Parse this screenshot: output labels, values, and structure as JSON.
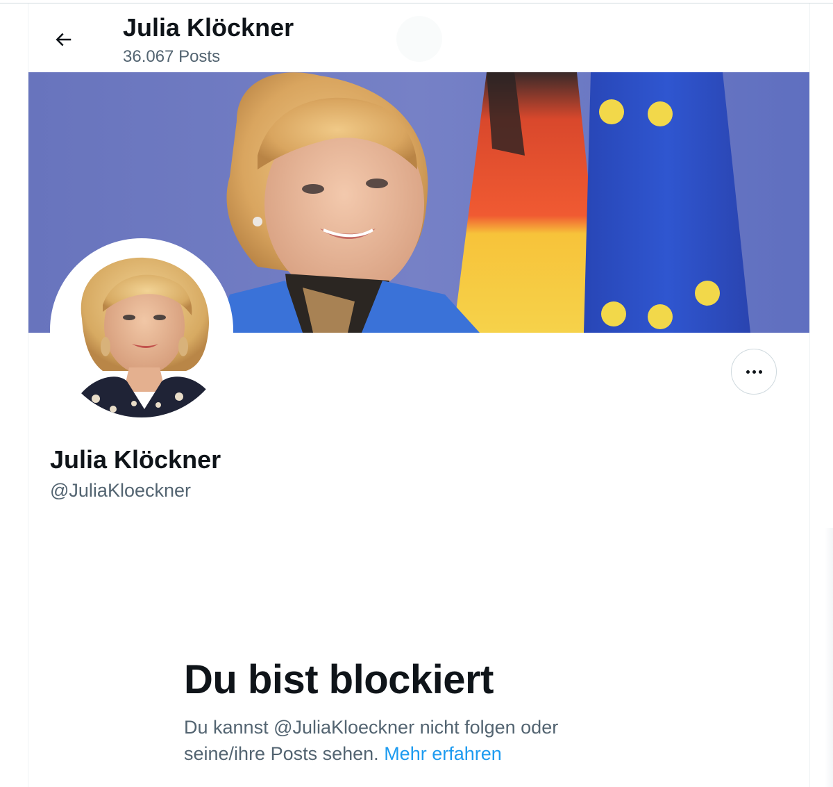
{
  "header": {
    "title": "Julia Klöckner",
    "post_count": "36.067 Posts"
  },
  "profile": {
    "name": "Julia Klöckner",
    "handle": "@JuliaKloeckner"
  },
  "blocked": {
    "title": "Du bist blockiert",
    "message": "Du kannst @JuliaKloeckner nicht folgen oder seine/ihre Posts sehen.",
    "link_label": "Mehr erfahren"
  },
  "icons": {
    "back": "arrow-left-icon",
    "more": "more-horizontal-icon"
  },
  "colors": {
    "text_primary": "#0f1419",
    "text_secondary": "#536471",
    "link": "#1d9bf0",
    "border": "#cfd9de"
  }
}
